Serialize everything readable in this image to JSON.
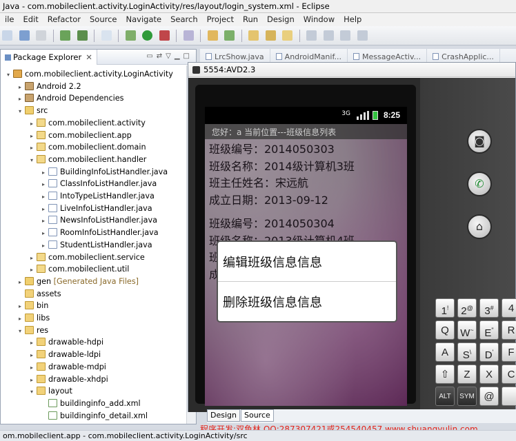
{
  "window": {
    "title": "Java - com.mobileclient.activity.LoginActivity/res/layout/login_system.xml - Eclipse"
  },
  "menu": [
    "ile",
    "Edit",
    "Refactor",
    "Source",
    "Navigate",
    "Search",
    "Project",
    "Run",
    "Design",
    "Window",
    "Help"
  ],
  "package_explorer": {
    "tab_label": "Package Explorer",
    "close_glyph": "✕",
    "tree": [
      {
        "label": "com.mobileclient.activity.LoginActivity",
        "indent": 0,
        "twisty": "▾",
        "icon": "project-icon"
      },
      {
        "label": "Android 2.2",
        "indent": 1,
        "twisty": "▸",
        "icon": "library-icon"
      },
      {
        "label": "Android Dependencies",
        "indent": 1,
        "twisty": "▸",
        "icon": "library-icon"
      },
      {
        "label": "src",
        "indent": 1,
        "twisty": "▾",
        "icon": "source-folder-icon"
      },
      {
        "label": "com.mobileclient.activity",
        "indent": 2,
        "twisty": "▸",
        "icon": "package-icon"
      },
      {
        "label": "com.mobileclient.app",
        "indent": 2,
        "twisty": "▸",
        "icon": "package-icon"
      },
      {
        "label": "com.mobileclient.domain",
        "indent": 2,
        "twisty": "▸",
        "icon": "package-icon"
      },
      {
        "label": "com.mobileclient.handler",
        "indent": 2,
        "twisty": "▾",
        "icon": "package-icon"
      },
      {
        "label": "BuildingInfoListHandler.java",
        "indent": 3,
        "twisty": "▸",
        "icon": "java-file-icon"
      },
      {
        "label": "ClassInfoListHandler.java",
        "indent": 3,
        "twisty": "▸",
        "icon": "java-file-icon"
      },
      {
        "label": "IntoTypeListHandler.java",
        "indent": 3,
        "twisty": "▸",
        "icon": "java-file-icon"
      },
      {
        "label": "LiveInfoListHandler.java",
        "indent": 3,
        "twisty": "▸",
        "icon": "java-file-icon"
      },
      {
        "label": "NewsInfoListHandler.java",
        "indent": 3,
        "twisty": "▸",
        "icon": "java-file-icon"
      },
      {
        "label": "RoomInfoListHandler.java",
        "indent": 3,
        "twisty": "▸",
        "icon": "java-file-icon"
      },
      {
        "label": "StudentListHandler.java",
        "indent": 3,
        "twisty": "▸",
        "icon": "java-file-icon"
      },
      {
        "label": "com.mobileclient.service",
        "indent": 2,
        "twisty": "▸",
        "icon": "package-icon"
      },
      {
        "label": "com.mobileclient.util",
        "indent": 2,
        "twisty": "▸",
        "icon": "package-icon"
      },
      {
        "label": "gen",
        "suffix": " [Generated Java Files]",
        "indent": 1,
        "twisty": "▸",
        "icon": "source-folder-icon"
      },
      {
        "label": "assets",
        "indent": 1,
        "twisty": "",
        "icon": "folder-icon"
      },
      {
        "label": "bin",
        "indent": 1,
        "twisty": "▸",
        "icon": "folder-icon"
      },
      {
        "label": "libs",
        "indent": 1,
        "twisty": "▸",
        "icon": "folder-icon"
      },
      {
        "label": "res",
        "indent": 1,
        "twisty": "▾",
        "icon": "folder-icon"
      },
      {
        "label": "drawable-hdpi",
        "indent": 2,
        "twisty": "▸",
        "icon": "folder-icon"
      },
      {
        "label": "drawable-ldpi",
        "indent": 2,
        "twisty": "▸",
        "icon": "folder-icon"
      },
      {
        "label": "drawable-mdpi",
        "indent": 2,
        "twisty": "▸",
        "icon": "folder-icon"
      },
      {
        "label": "drawable-xhdpi",
        "indent": 2,
        "twisty": "▸",
        "icon": "folder-icon"
      },
      {
        "label": "layout",
        "indent": 2,
        "twisty": "▾",
        "icon": "folder-icon"
      },
      {
        "label": "buildinginfo_add.xml",
        "indent": 3,
        "twisty": "",
        "icon": "xml-file-icon"
      },
      {
        "label": "buildinginfo_detail.xml",
        "indent": 3,
        "twisty": "",
        "icon": "xml-file-icon"
      }
    ]
  },
  "editor_tabs": [
    "LrcShow.java",
    "AndroidManif...",
    "MessageActiv...",
    "CrashApplic..."
  ],
  "emulator": {
    "title": "5554:AVD2.3",
    "status_time": "8:25",
    "status_network": "3G",
    "app_bar_text": "您好：a    当前位置---班级信息列表",
    "records": [
      {
        "lines": [
          "班级编号：2014050303",
          "班级名称：2014级计算机3班",
          "班主任姓名：宋远航",
          "成立日期：2013-09-12"
        ]
      },
      {
        "lines": [
          "班级编号：2014050304",
          "班级名称：2013级计算机4班",
          "班",
          "成"
        ]
      }
    ],
    "dialog": {
      "options": [
        "编辑班级信息信息",
        "删除班级信息信息"
      ]
    },
    "keys": [
      {
        "label": "1",
        "sup": "!"
      },
      {
        "label": "2",
        "sup": "@"
      },
      {
        "label": "3",
        "sup": "#"
      },
      {
        "label": "4",
        "sup": ""
      },
      {
        "label": "Q",
        "sup": ""
      },
      {
        "label": "W",
        "sup": "~"
      },
      {
        "label": "E",
        "sup": "\""
      },
      {
        "label": "R",
        "sup": ""
      },
      {
        "label": "A",
        "sup": ""
      },
      {
        "label": "S",
        "sup": "\\"
      },
      {
        "label": "D",
        "sup": "'"
      },
      {
        "label": "F",
        "sup": ""
      },
      {
        "label": "⇧",
        "sup": ""
      },
      {
        "label": "Z",
        "sup": ""
      },
      {
        "label": "X",
        "sup": ""
      },
      {
        "label": "C",
        "sup": ""
      },
      {
        "label": "ALT",
        "sup": ""
      },
      {
        "label": "SYM",
        "sup": ""
      },
      {
        "label": "@",
        "sup": ""
      },
      {
        "label": "",
        "sup": ""
      }
    ]
  },
  "design_tabs": [
    "Design",
    "Source"
  ],
  "watermark_footer": "程序开发:双鱼林 QQ:287307421或254540457 www.shuangyulin.com",
  "statusbar": "om.mobileclient.app - com.mobileclient.activity.LoginActivity/src"
}
